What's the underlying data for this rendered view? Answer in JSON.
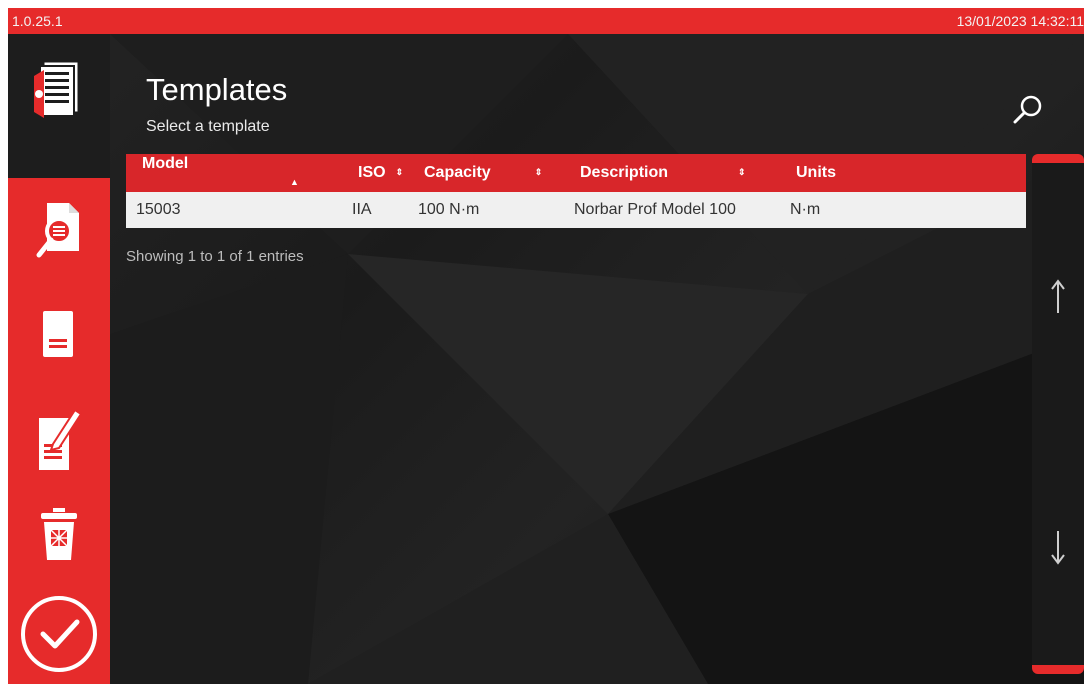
{
  "status_bar": {
    "version": "1.0.25.1",
    "datetime": "13/01/2023 14:32:11"
  },
  "header": {
    "title": "Templates",
    "subtitle": "Select a template",
    "search_icon": "search-icon"
  },
  "sidebar": {
    "items": [
      {
        "name": "view-template",
        "icon": "search-document-icon"
      },
      {
        "name": "document",
        "icon": "document-icon"
      },
      {
        "name": "edit",
        "icon": "edit-document-icon"
      },
      {
        "name": "delete",
        "icon": "trash-icon"
      },
      {
        "name": "confirm",
        "icon": "check-circle-icon"
      }
    ]
  },
  "table": {
    "columns": [
      "Model",
      "ISO",
      "Capacity",
      "Description",
      "Units"
    ],
    "rows": [
      [
        "15003",
        "IIA",
        "100 N·m",
        "Norbar Prof Model 100",
        "N·m"
      ]
    ],
    "info": "Showing 1 to 1 of 1 entries"
  },
  "scroll": {
    "up_icon": "arrow-up-icon",
    "down_icon": "arrow-down-icon"
  },
  "colors": {
    "accent": "#e62b2b",
    "background": "#1f1f1f"
  }
}
